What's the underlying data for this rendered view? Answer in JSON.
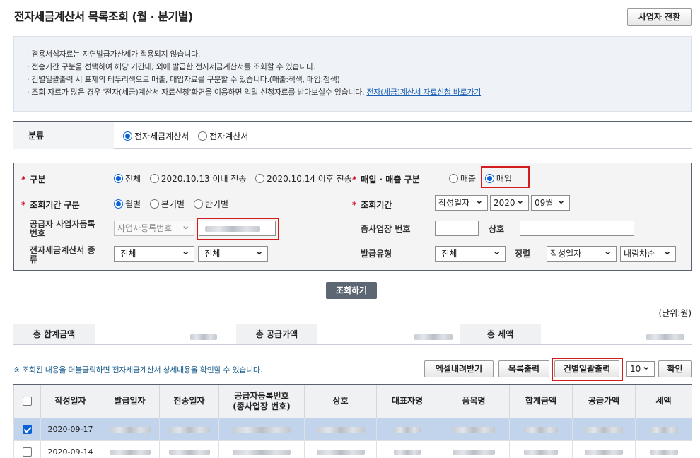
{
  "page": {
    "title": "전자세금계산서 목록조회 (월 · 분기별)",
    "switch_label": "사업자 전환"
  },
  "notice": {
    "lines": [
      "· 겸용서식자료는 지연발급가산세가 적용되지 않습니다.",
      "· 전송기간 구분을 선택하여 해당 기간내, 외에 발급한 전자세금계산서를 조회할 수 있습니다.",
      "· 건별일괄출력 시 표제의 테두리색으로 매출, 매입자료를 구분할 수 있습니다.(매출:적색, 매입:청색)",
      "· 조회 자료가 많은 경우 '전자(세금)계산서 자료신청'화면을 이용하면 익일 신청자료를 받아보실수 있습니다. "
    ],
    "link": "전자(세금)계산서 자료신청 바로가기"
  },
  "classification": {
    "label": "분류",
    "options": [
      "전자세금계산서",
      "전자계산서"
    ],
    "selected": "전자세금계산서"
  },
  "search": {
    "type_label": "구분",
    "type_options": [
      "전체",
      "2020.10.13 이내 전송",
      "2020.10.14 이후 전송"
    ],
    "type_selected": "전체",
    "trade_label": "매입 · 매출 구분",
    "trade_options": [
      "매출",
      "매입"
    ],
    "trade_selected": "매입",
    "period_type_label": "조회기간 구분",
    "period_type_options": [
      "월별",
      "분기별",
      "반기별"
    ],
    "period_type_selected": "월별",
    "period_label": "조회기간",
    "date_basis": "작성일자",
    "year": "2020",
    "month": "09월",
    "supplier_label": "공급자 사업자등록번호",
    "supplier_select": "사업자등록번호",
    "branch_label": "종사업장 번호",
    "company_label": "상호",
    "invoice_type_label": "전자세금계산서 종류",
    "invoice_type_a": "-전체-",
    "invoice_type_b": "-전체-",
    "issue_type_label": "발급유형",
    "issue_type": "-전체-",
    "sort_label": "정렬",
    "sort_field": "작성일자",
    "sort_order": "내림차순",
    "button": "조회하기"
  },
  "unit": "(단위:원)",
  "summary": {
    "total_label": "총 합계금액",
    "supply_label": "총 공급가액",
    "tax_label": "총 세액"
  },
  "toolbar": {
    "hint": "※ 조회된 내용을 더블클릭하면 전자세금계산서 상세내용을 확인할 수 있습니다.",
    "excel": "엑셀내려받기",
    "print_list": "목록출력",
    "print_batch": "건별일괄출력",
    "page_size": "10",
    "confirm": "확인"
  },
  "table": {
    "headers": [
      "작성일자",
      "발급일자",
      "전송일자",
      "공급자등록번호\n(종사업장 번호)",
      "상호",
      "대표자명",
      "품목명",
      "합계금액",
      "공급가액",
      "세액"
    ],
    "rows": [
      {
        "checked": true,
        "date": "2020-09-17"
      },
      {
        "checked": false,
        "date": "2020-09-14"
      }
    ]
  }
}
